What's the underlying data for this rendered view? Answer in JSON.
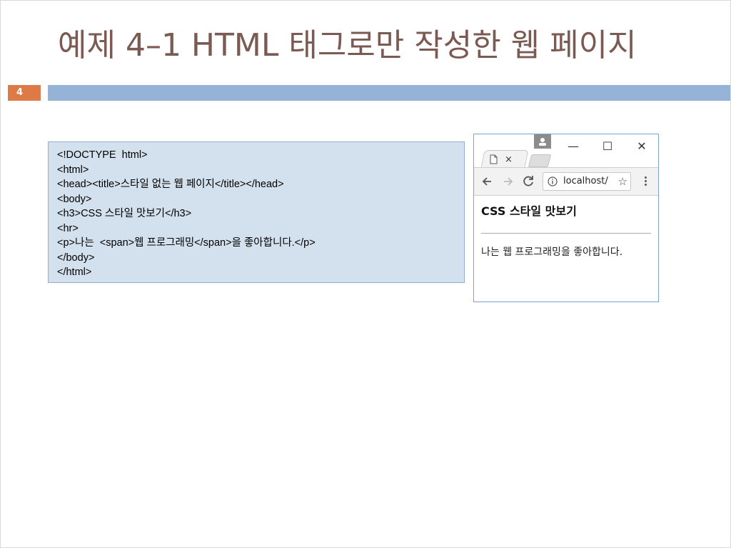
{
  "slide": {
    "title": "예제 4–1 HTML 태그로만 작성한 웹 페이지",
    "number": "4"
  },
  "code": {
    "lines": [
      "<!DOCTYPE  html>",
      "<html>",
      "<head><title>스타일 없는 웹 페이지</title></head>",
      "<body>",
      "<h3>CSS 스타일 맛보기</h3>",
      "<hr>",
      "<p>나는  <span>웹 프로그래밍</span>을 좋아합니다.</p>",
      "</body>",
      "</html>"
    ]
  },
  "browser": {
    "tab_close": "×",
    "window_controls": {
      "minimize": "—",
      "maximize": "☐",
      "close": "✕"
    },
    "icons": {
      "back": "back-arrow-icon",
      "forward": "forward-arrow-icon",
      "reload": "reload-icon",
      "info": "info-icon",
      "star": "star-icon",
      "menu": "menu-dots-icon",
      "page": "page-icon",
      "profile": "profile-icon"
    },
    "url": "localhost/",
    "star": "☆",
    "page": {
      "heading": "CSS 스타일 맛보기",
      "paragraph": "나는 웹 프로그래밍을 좋아합니다."
    }
  },
  "colors": {
    "title": "#7a5a52",
    "slide_number_bg": "#dd7a45",
    "accent_bar": "#95b3d7",
    "code_bg": "#d3e0ed",
    "code_border": "#8fb0d0",
    "browser_border": "#7aa4cf"
  }
}
